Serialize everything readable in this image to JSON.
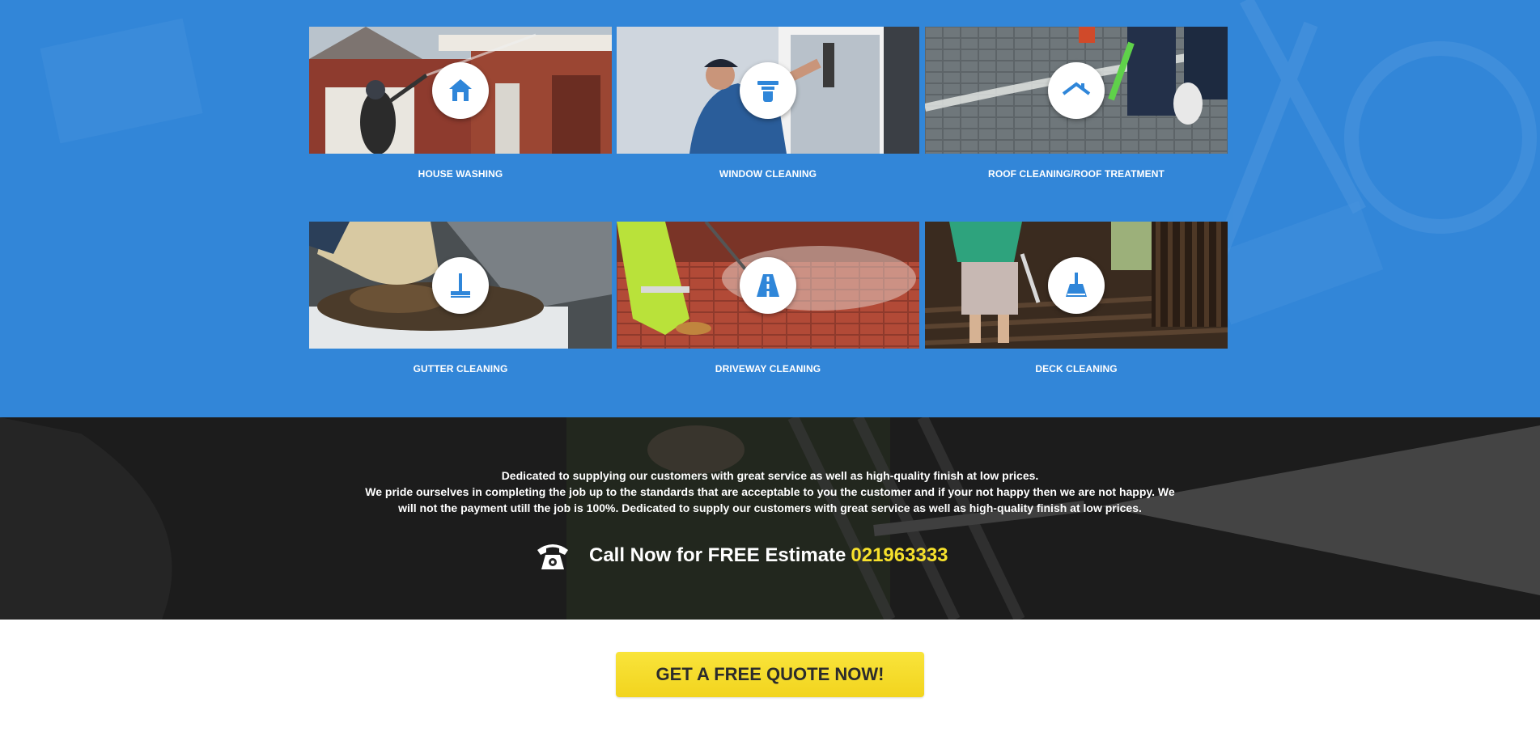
{
  "services": [
    {
      "name": "HOUSE WASHING",
      "icon": "house-icon"
    },
    {
      "name": "WINDOW CLEANING",
      "icon": "squeegee-icon"
    },
    {
      "name": "ROOF CLEANING/ROOF TREATMENT",
      "icon": "roof-icon"
    },
    {
      "name": "GUTTER CLEANING",
      "icon": "gutter-brush-icon"
    },
    {
      "name": "DRIVEWAY CLEANING",
      "icon": "road-icon"
    },
    {
      "name": "DECK CLEANING",
      "icon": "broom-icon"
    }
  ],
  "promo": {
    "line1": "Dedicated to supplying our customers with great service as well as high-quality finish at low prices.",
    "line2": "We pride ourselves in completing the job up to the standards that are acceptable to you the customer and if your not happy then we are not happy. We will not the payment utill the job is 100%. Dedicated to supply our customers with great service as well as high-quality finish at low prices.",
    "call_label": "Call Now for FREE Estimate",
    "phone": "021963333"
  },
  "cta": {
    "label": "GET A FREE QUOTE NOW!"
  },
  "colors": {
    "section_blue": "#3286d8",
    "icon_blue": "#2f86d9",
    "phone_yellow": "#f7e12c",
    "cta_yellow": "#f4d923"
  }
}
